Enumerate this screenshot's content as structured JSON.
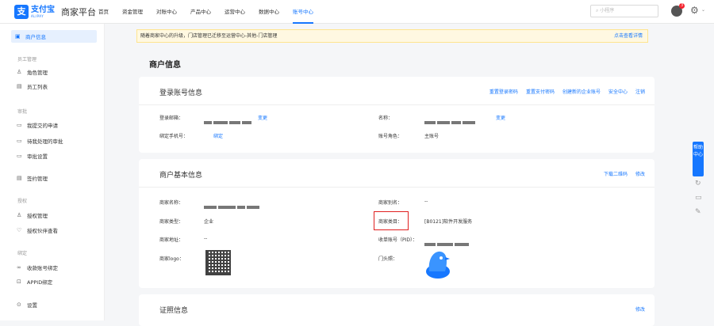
{
  "app": {
    "logo_cn": "支付宝",
    "logo_en": "ALIPAY",
    "platform": "商家平台"
  },
  "nav": {
    "items": [
      "首页",
      "资金管理",
      "对账中心",
      "产品中心",
      "运营中心",
      "数据中心",
      "账号中心"
    ],
    "active_index": 6
  },
  "search": {
    "placeholder": "小程序"
  },
  "header": {
    "notification_count": "3"
  },
  "sidebar": {
    "active": "商户信息",
    "items": [
      {
        "label": "商户信息",
        "icon": "merchant-icon"
      },
      {
        "label": "员工管理",
        "type": "group"
      },
      {
        "label": "角色管理",
        "icon": "role-icon"
      },
      {
        "label": "员工列表",
        "icon": "list-icon"
      },
      {
        "label": "审批",
        "type": "group"
      },
      {
        "label": "我提交的申请",
        "icon": "form-icon"
      },
      {
        "label": "待我处理的审批",
        "icon": "inbox-icon"
      },
      {
        "label": "审批设置",
        "icon": "settings-icon"
      },
      {
        "label": "签约管理",
        "icon": "contract-icon"
      },
      {
        "label": "授权",
        "type": "group"
      },
      {
        "label": "授权管理",
        "icon": "user-icon"
      },
      {
        "label": "授权伙伴查看",
        "icon": "heart-icon"
      },
      {
        "label": "绑定",
        "type": "group"
      },
      {
        "label": "收款账号绑定",
        "icon": "link-icon"
      },
      {
        "label": "APPID绑定",
        "icon": "lock-icon"
      },
      {
        "label": "设置",
        "icon": "gear-icon"
      }
    ]
  },
  "notice": {
    "text": "随着商家中心的升级，门店管理已迁移至运营中心-其他-门店管理",
    "link": "点击查看详情"
  },
  "page_title": "商户信息",
  "login_card": {
    "title": "登录账号信息",
    "links": [
      "重置登录密码",
      "重置支付密码",
      "创建新的企业账号",
      "安全中心",
      "注销"
    ],
    "email_label": "登录邮箱：",
    "email_change": "变更",
    "name_label": "名称：",
    "name_change": "变更",
    "phone_label": "绑定手机号：",
    "phone_value": "绑定",
    "role_label": "账号角色：",
    "role_value": "主账号"
  },
  "merchant_card": {
    "title": "商户基本信息",
    "links": [
      "下载二维码",
      "修改"
    ],
    "name_label": "商家名称：",
    "alias_label": "商家别名：",
    "alias_value": "--",
    "type_label": "商家类型：",
    "type_value": "企业",
    "category_label": "商家类目：",
    "category_value": "[B0121]软件开发服务",
    "address_label": "商家地址：",
    "address_value": "--",
    "pid_label": "收单账号（PID）：",
    "logo_label": "商家logo：",
    "door_label": "门头照："
  },
  "cert_card": {
    "title": "证照信息",
    "link": "修改"
  },
  "help": {
    "label": "帮助中心"
  }
}
